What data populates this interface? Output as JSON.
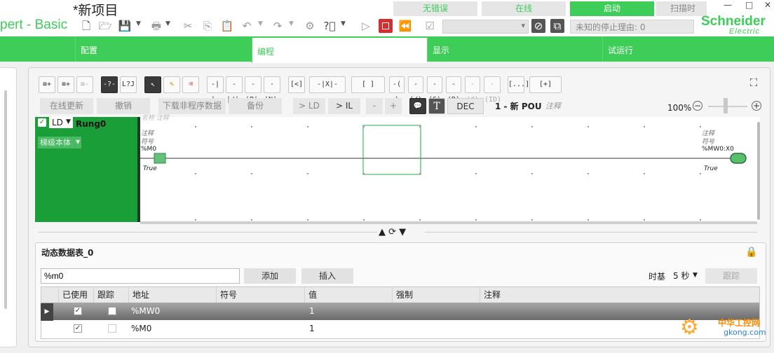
{
  "app": {
    "title": "pert - Basic",
    "project": "*新项目"
  },
  "status_tabs": [
    "无错误",
    "在线",
    "启动",
    "扫描时"
  ],
  "window_controls": [
    "—",
    "□",
    "✕"
  ],
  "toolbar": {
    "stop_reason": "未知的停止理由: 0",
    "combo_value": ""
  },
  "logo": {
    "line1": "Schneider",
    "line2": "Electric"
  },
  "main_tabs": [
    "配置",
    "编程",
    "显示",
    "试运行"
  ],
  "ld_toolbar": {
    "buttons": [
      "≡+",
      "≡+",
      "≡-",
      "-?-",
      "L?J",
      "↖",
      "✎",
      "⌫",
      "-| |-",
      "-|/|-",
      "-|P|-",
      "-|N|-",
      "[<]",
      "-|X|-",
      "[ ]",
      "-( )",
      "-(/)",
      "-(S)",
      "-(R)",
      "-(#)",
      "-(ID)",
      "[...]",
      "[+]"
    ]
  },
  "action_buttons": [
    "在线更新",
    "撤销",
    "下载非程序数据",
    "备份",
    "> LD",
    "> IL",
    "-",
    "+",
    "DEC"
  ],
  "pou": {
    "label": "1 - 新 POU",
    "comment": "注释"
  },
  "zoom": {
    "value": "100%",
    "level": 0.4
  },
  "rung": {
    "language": "LD",
    "name": "Rung0",
    "body_btn": "梯级本体",
    "header_faded": "名称  注释",
    "left": {
      "comment": "注释",
      "symbol": "符号",
      "address": "%M0",
      "value": "True"
    },
    "right": {
      "comment": "注释",
      "symbol": "符号",
      "address": "%MW0:X0",
      "value": "True"
    }
  },
  "dyn_table": {
    "title": "动态数据表_0",
    "search_value": "%m0",
    "add": "添加",
    "insert": "插入",
    "time_base_label": "时基",
    "time_base": "5 秒",
    "trace": "跟踪",
    "columns": [
      "已使用",
      "跟踪",
      "地址",
      "符号",
      "值",
      "强制",
      "注释"
    ],
    "rows": [
      {
        "used": true,
        "trace": false,
        "address": "%MW0",
        "symbol": "",
        "value": "1",
        "force": "",
        "comment": ""
      },
      {
        "used": true,
        "trace": false,
        "address": "%M0",
        "symbol": "",
        "value": "1",
        "force": "",
        "comment": ""
      }
    ]
  },
  "watermark": {
    "line1": "中华工控网",
    "line2": "gkong.com"
  }
}
